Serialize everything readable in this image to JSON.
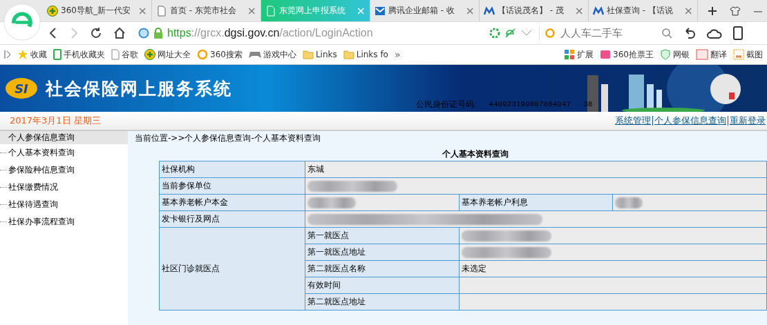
{
  "browser": {
    "tabs": [
      {
        "title": "360导航_新一代安",
        "kind": "plus",
        "close": "×",
        "selected": false
      },
      {
        "title": "首页 - 东莞市社会",
        "kind": "page",
        "close": "×",
        "selected": false
      },
      {
        "title": "东莞网上申报系统",
        "kind": "page",
        "close": "×",
        "selected": true
      },
      {
        "title": "腾讯企业邮箱 - 收",
        "kind": "mail",
        "close": "×",
        "selected": false
      },
      {
        "title": "【话说茂名】 - 茂",
        "kind": "m",
        "close": "×",
        "selected": false
      },
      {
        "title": "社保查询 - 【话说",
        "kind": "m",
        "close": "×",
        "selected": false
      }
    ],
    "url": {
      "scheme": "https",
      "sep": "://grcx.",
      "host": "dgsi.gov.cn",
      "path": "/action/LoginAction"
    },
    "search": {
      "placeholder": "人人车二手车"
    },
    "bookmarks": [
      {
        "label": "收藏",
        "kind": "star"
      },
      {
        "label": "手机收藏夹",
        "kind": "phone"
      },
      {
        "label": "谷歌",
        "kind": "page"
      },
      {
        "label": "网址大全",
        "kind": "plus"
      },
      {
        "label": "360搜索",
        "kind": "ring"
      },
      {
        "label": "游戏中心",
        "kind": "pad"
      },
      {
        "label": "Links",
        "kind": "folder"
      },
      {
        "label": "Links fo",
        "kind": "folder"
      }
    ],
    "more": "»",
    "tools": [
      {
        "label": "扩展",
        "kind": "grid"
      },
      {
        "label": "360抢票王",
        "kind": "ticket"
      },
      {
        "label": "网银",
        "kind": "shield"
      },
      {
        "label": "翻译",
        "kind": "aa"
      },
      {
        "label": "截图",
        "kind": "scissors"
      }
    ]
  },
  "site": {
    "title": "社会保险网上服务系统",
    "logo": "SI",
    "id_label": "公民身份证号码:",
    "id_value": "440923199007064047",
    "id_tail": "38",
    "date": "2017年3月1日 星期三",
    "links": [
      "系统管理",
      "个人参保信息查询",
      "重新登录"
    ],
    "sidebar": {
      "title": "个人参保信息查询",
      "items": [
        {
          "label": "个人基本资料查询"
        },
        {
          "label": "参保险种信息查询"
        },
        {
          "label": "社保缴费情况"
        },
        {
          "label": "社保待遇查询"
        },
        {
          "label": "社保办事流程查询"
        }
      ]
    },
    "breadcrumb": "当前位置->>个人参保信息查询-个人基本资料查询",
    "table": {
      "title": "个人基本资料查询",
      "rows": [
        {
          "label": "社保机构",
          "value": {
            "kind": "text",
            "text": "东城"
          }
        },
        {
          "label": "当前参保单位",
          "value": {
            "kind": "redacted"
          }
        },
        {
          "label": "基本养老帐户本金",
          "value": {
            "kind": "redacted"
          },
          "label2": "基本养老帐户利息",
          "value2": {
            "kind": "redacted"
          }
        },
        {
          "label": "发卡银行及网点",
          "value": {
            "kind": "redacted"
          }
        }
      ],
      "group": {
        "label": "社区门诊就医点",
        "rows": [
          {
            "label": "第一就医点",
            "value": {
              "kind": "redacted"
            }
          },
          {
            "label": "第一就医点地址",
            "value": {
              "kind": "redacted"
            }
          },
          {
            "label": "第二就医点名称",
            "value": {
              "kind": "text",
              "text": "未选定"
            }
          },
          {
            "label": "有效时间",
            "value": {
              "kind": "empty"
            }
          },
          {
            "label": "第二就医点地址",
            "value": {
              "kind": "empty"
            }
          }
        ]
      }
    }
  }
}
